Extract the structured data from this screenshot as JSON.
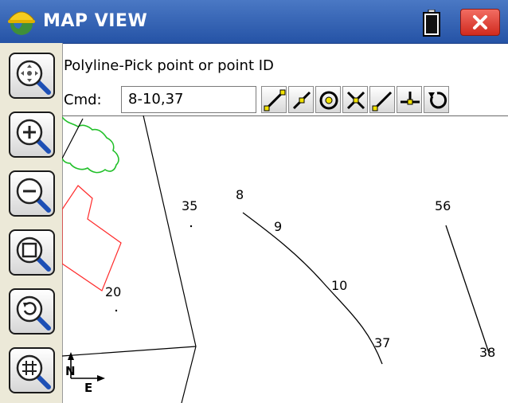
{
  "window": {
    "title": "MAP VIEW",
    "accent_color": "#2d5cb0",
    "close_color": "#e0352b"
  },
  "icons": {
    "app_logo": "hardhat-globe-icon",
    "battery": "battery-icon",
    "close": "close-icon"
  },
  "toolbar": {
    "buttons": [
      {
        "name": "zoom-extents",
        "icon": "zoom-extents-icon"
      },
      {
        "name": "zoom-in",
        "icon": "zoom-in-icon"
      },
      {
        "name": "zoom-out",
        "icon": "zoom-out-icon"
      },
      {
        "name": "zoom-window",
        "icon": "zoom-window-icon"
      },
      {
        "name": "zoom-previous",
        "icon": "zoom-previous-icon"
      },
      {
        "name": "zoom-grid",
        "icon": "zoom-grid-icon"
      }
    ]
  },
  "command": {
    "prompt": "Polyline-Pick point or point ID",
    "label": "Cmd:",
    "value": "8-10,37"
  },
  "snap_tools": [
    {
      "name": "line",
      "icon": "snap-line-icon"
    },
    {
      "name": "midpoint",
      "icon": "snap-midpoint-icon"
    },
    {
      "name": "center",
      "icon": "snap-center-icon"
    },
    {
      "name": "intersection",
      "icon": "snap-intersection-icon"
    },
    {
      "name": "endpoint",
      "icon": "snap-endpoint-icon"
    },
    {
      "name": "perpendicular",
      "icon": "snap-perpendicular-icon"
    },
    {
      "name": "rotate",
      "icon": "snap-rotate-icon"
    }
  ],
  "map": {
    "points": [
      "35",
      "8",
      "9",
      "10",
      "37",
      "20",
      "56",
      "38"
    ],
    "north_label": "N",
    "east_label": "E"
  }
}
